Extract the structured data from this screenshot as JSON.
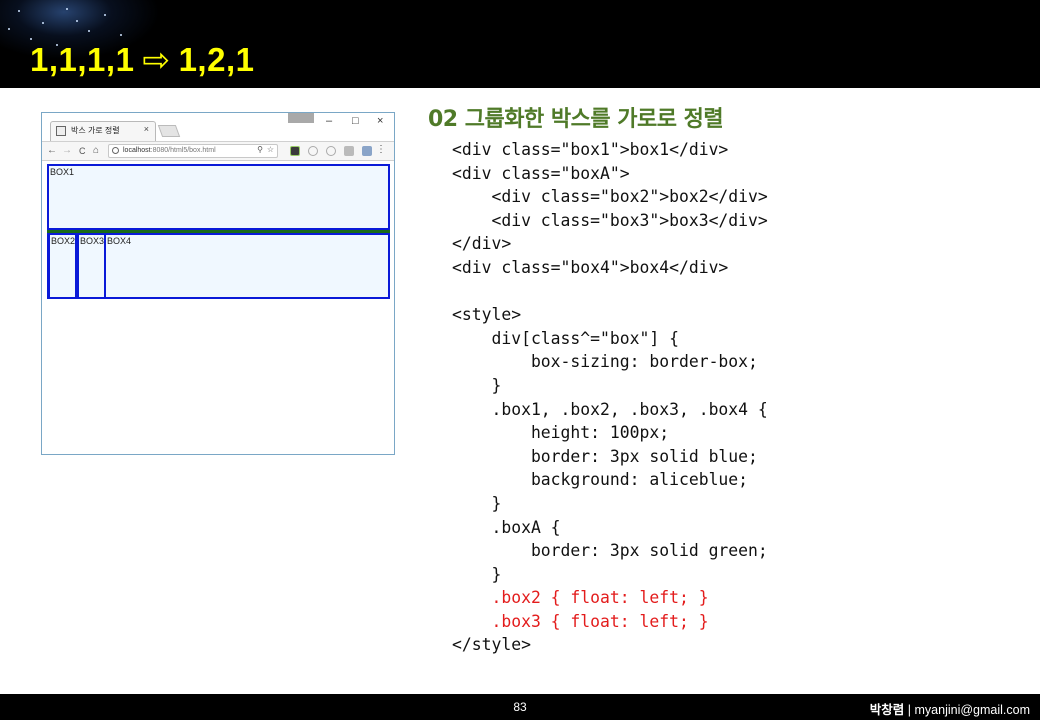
{
  "slide": {
    "title_left": "1,1,1,1",
    "title_arrow": "⇨",
    "title_right": "1,2,1",
    "section_heading": "02 그룹화한 박스를 가로로 정렬"
  },
  "browser": {
    "tab_title": "박스 가로 정렬",
    "tab_close": "×",
    "window_badge": "",
    "btn_minimize": "–",
    "btn_maximize": "□",
    "btn_close": "×",
    "nav_back": "←",
    "nav_forward": "→",
    "nav_reload": "C",
    "nav_home": "⌂",
    "url_host": "localhost",
    "url_rest": ":8080/html5/box.html",
    "url_zoom": "⚲",
    "url_star": "☆",
    "menu": "⋮",
    "boxes": {
      "box1": "BOX1",
      "box2": "BOX2",
      "box3": "BOX3",
      "box4": "BOX4"
    }
  },
  "code_lines": [
    {
      "text": "<div class=\"box1\">box1</div>",
      "highlight": false
    },
    {
      "text": "<div class=\"boxA\">",
      "highlight": false
    },
    {
      "text": "    <div class=\"box2\">box2</div>",
      "highlight": false
    },
    {
      "text": "    <div class=\"box3\">box3</div>",
      "highlight": false
    },
    {
      "text": "</div>",
      "highlight": false
    },
    {
      "text": "<div class=\"box4\">box4</div>",
      "highlight": false
    },
    {
      "text": "",
      "highlight": false
    },
    {
      "text": "<style>",
      "highlight": false
    },
    {
      "text": "    div[class^=\"box\"] {",
      "highlight": false
    },
    {
      "text": "        box-sizing: border-box;",
      "highlight": false
    },
    {
      "text": "    }",
      "highlight": false
    },
    {
      "text": "    .box1, .box2, .box3, .box4 {",
      "highlight": false
    },
    {
      "text": "        height: 100px;",
      "highlight": false
    },
    {
      "text": "        border: 3px solid blue;",
      "highlight": false
    },
    {
      "text": "        background: aliceblue;",
      "highlight": false
    },
    {
      "text": "    }",
      "highlight": false
    },
    {
      "text": "    .boxA {",
      "highlight": false
    },
    {
      "text": "        border: 3px solid green;",
      "highlight": false
    },
    {
      "text": "    }",
      "highlight": false
    },
    {
      "text": "    .box2 { float: left; }",
      "highlight": true
    },
    {
      "text": "    .box3 { float: left; }",
      "highlight": true
    },
    {
      "text": "</style>",
      "highlight": false
    }
  ],
  "footer": {
    "page_number": "83",
    "author_name": "박창렴",
    "author_sep": " | ",
    "author_email": "myanjini@gmail.com"
  },
  "colors": {
    "title": "#ffff00",
    "heading": "#4f7a28",
    "code_highlight": "#e31c1c",
    "box_border": "#0a1ad8",
    "box_bg": "#f0f8ff",
    "group_border": "#1a6a1a"
  }
}
